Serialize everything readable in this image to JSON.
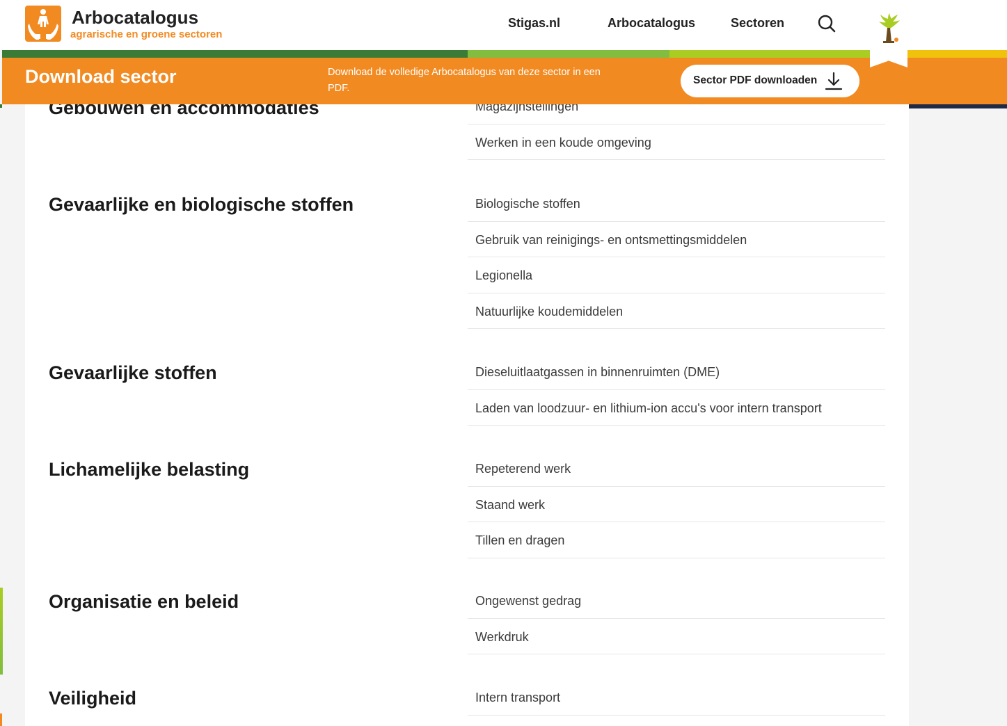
{
  "header": {
    "logo_title": "Arbocatalogus",
    "logo_subtitle": "agrarische en groene sectoren",
    "nav": [
      "Stigas.nl",
      "Arbocatalogus",
      "Sectoren"
    ]
  },
  "download_bar": {
    "title": "Download sector",
    "text": "Download de volledige Arbocatalogus van deze sector in een PDF.",
    "button_label": "Sector PDF downloaden"
  },
  "colors": {
    "brand_orange": "#f28a22",
    "stripe_dark_green": "#3a7b35",
    "stripe_green": "#82bd3f",
    "stripe_lime": "#a9cd22",
    "stripe_yellow": "#f0c20c"
  },
  "categories": [
    {
      "title": "Gebouwen en accommodaties",
      "items": [
        "Magazijnstellingen",
        "Werken in een koude omgeving"
      ]
    },
    {
      "title": "Gevaarlijke en biologische stoffen",
      "items": [
        "Biologische stoffen",
        "Gebruik van reinigings- en ontsmettingsmiddelen",
        "Legionella",
        "Natuurlijke koudemiddelen"
      ]
    },
    {
      "title": "Gevaarlijke stoffen",
      "items": [
        "Dieseluitlaatgassen in binnenruimten (DME)",
        "Laden van loodzuur- en lithium-ion accu's voor intern transport"
      ]
    },
    {
      "title": "Lichamelijke belasting",
      "items": [
        "Repeterend werk",
        "Staand werk",
        "Tillen en dragen"
      ]
    },
    {
      "title": "Organisatie en beleid",
      "items": [
        "Ongewenst gedrag",
        "Werkdruk"
      ]
    },
    {
      "title": "Veiligheid",
      "items": [
        "Intern transport"
      ]
    }
  ]
}
